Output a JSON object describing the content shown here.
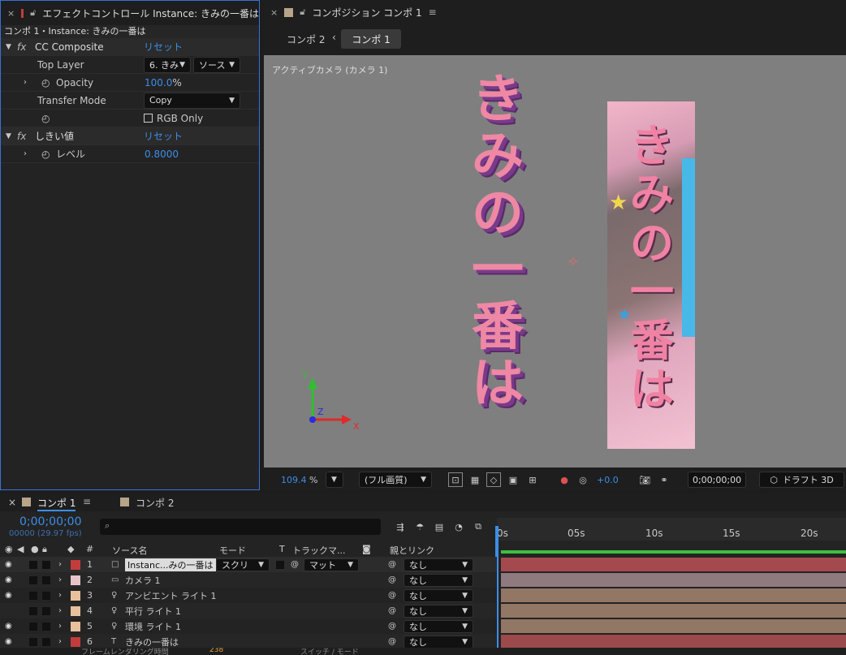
{
  "effect_panel": {
    "tab_title": "エフェクトコントロール Instance: きみの一番は",
    "breadcrumb": "コンポ 1・Instance: きみの一番は",
    "effects": [
      {
        "name": "CC Composite",
        "reset": "リセット"
      },
      {
        "name": "しきい値",
        "reset": "リセット"
      }
    ],
    "props": {
      "top_layer_label": "Top Layer",
      "top_layer_value": "6. きみ",
      "top_layer_source": "ソース",
      "opacity_label": "Opacity",
      "opacity_value": "100.0",
      "opacity_unit": "%",
      "transfer_label": "Transfer Mode",
      "transfer_value": "Copy",
      "rgb_only_label": "RGB Only",
      "level_label": "レベル",
      "level_value": "0.8000"
    }
  },
  "comp_panel": {
    "tab_title": "コンポジション コンポ 1",
    "breadcrumb_prev": "コンポ 2",
    "breadcrumb_current": "コンポ 1",
    "camera_label": "アクティブカメラ (カメラ 1)",
    "canvas_text": [
      "き",
      "み",
      "の",
      "一",
      "番",
      "は"
    ],
    "axis_x": "X",
    "axis_y": "Y",
    "axis_z": "Z",
    "zoom": "109.4",
    "zoom_unit": "%",
    "quality": "(フル画質)",
    "exposure": "+0.0",
    "timecode": "0;00;00;00",
    "renderer": "ドラフト 3D"
  },
  "timeline": {
    "tabs": [
      "コンポ 1",
      "コンポ 2"
    ],
    "timecode": "0;00;00;00",
    "frames": "00000 (29.97 fps)",
    "search_placeholder": "",
    "columns": {
      "num": "#",
      "source": "ソース名",
      "mode": "モード",
      "t": "T",
      "track": "トラックマ...",
      "parent": "親とリンク"
    },
    "ruler": [
      "0s",
      "05s",
      "10s",
      "15s",
      "20s"
    ],
    "layers": [
      {
        "num": "1",
        "name": "Instanc...みの一番は",
        "mode": "スクリ",
        "track": "マット",
        "parent": "なし",
        "color": "#c33c3c",
        "bar": "#a44a4e"
      },
      {
        "num": "2",
        "name": "カメラ 1",
        "parent": "なし",
        "color": "#e7c3c9",
        "bar": "#8f7a80"
      },
      {
        "num": "3",
        "name": "アンビエント ライト 1",
        "parent": "なし",
        "color": "#e8c09c",
        "bar": "#927765"
      },
      {
        "num": "4",
        "name": "平行 ライト 1",
        "parent": "なし",
        "color": "#e8c09c",
        "bar": "#927765"
      },
      {
        "num": "5",
        "name": "環境 ライト 1",
        "parent": "なし",
        "color": "#e8c09c",
        "bar": "#927765"
      },
      {
        "num": "6",
        "name": "きみの一番は",
        "parent": "なし",
        "color": "#c33c3c",
        "bar": "#9c4a4c"
      }
    ],
    "bottom_left": "フレームレンダリング時間",
    "bottom_left_value": "238",
    "bottom_mid": "スイッチ / モード"
  }
}
